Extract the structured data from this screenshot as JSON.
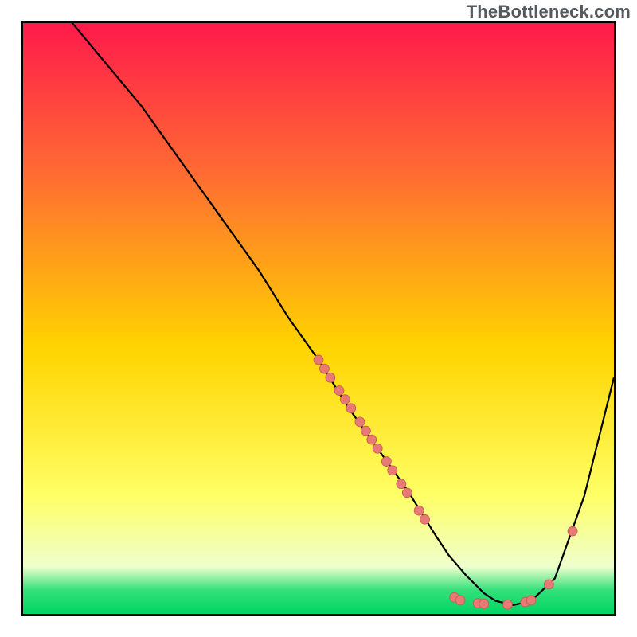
{
  "watermark": "TheBottleneck.com",
  "colors": {
    "gradient_top": "#ff1a4b",
    "gradient_upper": "#ff6a33",
    "gradient_mid": "#ffd400",
    "gradient_lower": "#ffff66",
    "gradient_band_pale": "#eeffcc",
    "gradient_band_green": "#33e07a",
    "gradient_bottom": "#00d563",
    "curve": "#000000",
    "marker_fill": "#e77a74",
    "marker_stroke": "#c95a55",
    "border": "#000000"
  },
  "chart_data": {
    "type": "line",
    "title": "",
    "xlabel": "",
    "ylabel": "",
    "xlim": [
      0,
      100
    ],
    "ylim": [
      0,
      100
    ],
    "curve": {
      "x": [
        0,
        5,
        10,
        15,
        20,
        25,
        30,
        35,
        40,
        45,
        50,
        55,
        60,
        65,
        70,
        72,
        75,
        78,
        80,
        83,
        86,
        90,
        95,
        100
      ],
      "y": [
        110,
        104,
        98,
        92,
        86,
        79,
        72,
        65,
        58,
        50,
        43,
        35,
        28,
        21,
        13,
        10,
        6.5,
        3.5,
        2.2,
        1.5,
        2.2,
        6,
        20,
        40
      ]
    },
    "markers": [
      {
        "x": 50,
        "y": 43
      },
      {
        "x": 51,
        "y": 41.5
      },
      {
        "x": 52,
        "y": 40
      },
      {
        "x": 53.5,
        "y": 37.8
      },
      {
        "x": 54.5,
        "y": 36.3
      },
      {
        "x": 55.5,
        "y": 34.8
      },
      {
        "x": 57,
        "y": 32.5
      },
      {
        "x": 58,
        "y": 31
      },
      {
        "x": 59,
        "y": 29.5
      },
      {
        "x": 60,
        "y": 28
      },
      {
        "x": 61.5,
        "y": 25.8
      },
      {
        "x": 62.5,
        "y": 24.3
      },
      {
        "x": 64,
        "y": 22
      },
      {
        "x": 65,
        "y": 20.5
      },
      {
        "x": 67,
        "y": 17.5
      },
      {
        "x": 68,
        "y": 16
      },
      {
        "x": 73,
        "y": 2.8
      },
      {
        "x": 74,
        "y": 2.3
      },
      {
        "x": 77,
        "y": 1.8
      },
      {
        "x": 78,
        "y": 1.7
      },
      {
        "x": 82,
        "y": 1.6
      },
      {
        "x": 85,
        "y": 2.0
      },
      {
        "x": 86,
        "y": 2.3
      },
      {
        "x": 89,
        "y": 5.0
      },
      {
        "x": 93,
        "y": 14
      }
    ],
    "marker_radius": 6
  }
}
